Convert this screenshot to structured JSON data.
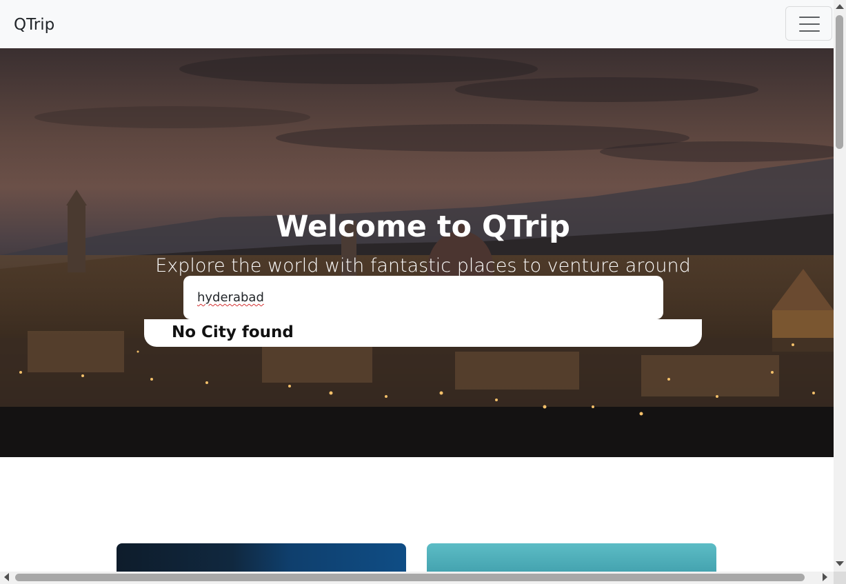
{
  "navbar": {
    "brand": "QTrip",
    "menu_icon": "hamburger-menu-icon"
  },
  "hero": {
    "title": "Welcome to QTrip",
    "subtitle": "Explore the world with fantastic places to venture around",
    "search_value": "hyderabad",
    "results_message": "No City found"
  },
  "colors": {
    "navbar_bg": "#f8f9fa",
    "hero_text": "#ffffff",
    "brand_text": "#212529"
  }
}
